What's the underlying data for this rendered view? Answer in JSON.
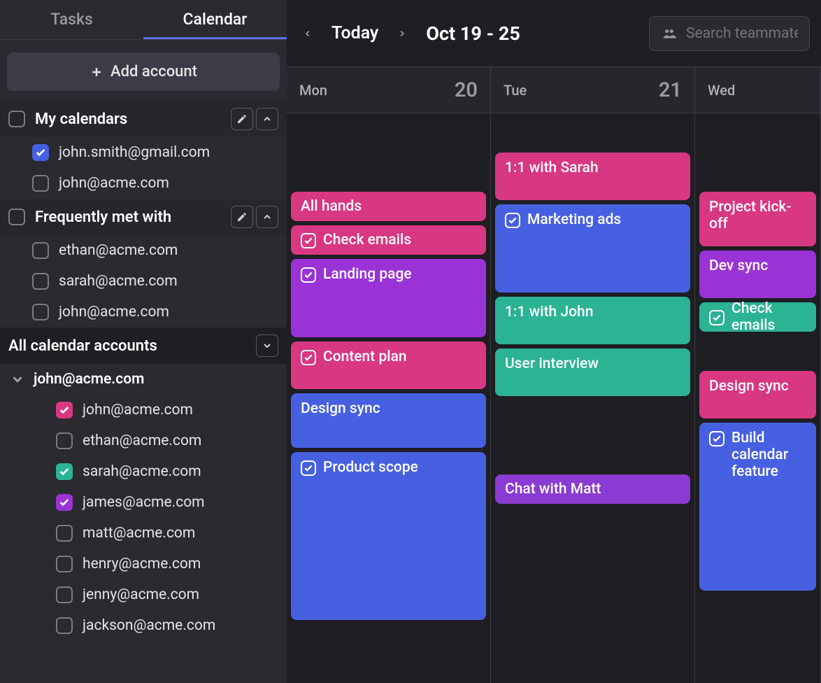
{
  "sidebar": {
    "tabs": [
      {
        "label": "Tasks",
        "active": false
      },
      {
        "label": "Calendar",
        "active": true
      }
    ],
    "add_account_label": "Add account",
    "sections": [
      {
        "id": "my-calendars",
        "title": "My calendars",
        "has_edit": true,
        "has_collapse": true,
        "items": [
          {
            "label": "john.smith@gmail.com",
            "checked": true,
            "color": "#4760e1"
          },
          {
            "label": "john@acme.com",
            "checked": false
          }
        ]
      },
      {
        "id": "frequently-met",
        "title": "Frequently met with",
        "has_edit": true,
        "has_collapse": true,
        "items": [
          {
            "label": "ethan@acme.com",
            "checked": false
          },
          {
            "label": "sarah@acme.com",
            "checked": false
          },
          {
            "label": "john@acme.com",
            "checked": false
          }
        ]
      }
    ],
    "all_accounts_title": "All calendar accounts",
    "accounts": [
      {
        "email": "john@acme.com",
        "expanded": true,
        "calendars": [
          {
            "label": "john@acme.com",
            "checked": true,
            "color": "#d83781"
          },
          {
            "label": "ethan@acme.com",
            "checked": false
          },
          {
            "label": "sarah@acme.com",
            "checked": true,
            "color": "#2bb394"
          },
          {
            "label": "james@acme.com",
            "checked": true,
            "color": "#9a33d6"
          },
          {
            "label": "matt@acme.com",
            "checked": false
          },
          {
            "label": "henry@acme.com",
            "checked": false
          },
          {
            "label": "jenny@acme.com",
            "checked": false
          },
          {
            "label": "jackson@acme.com",
            "checked": false
          }
        ]
      }
    ]
  },
  "header": {
    "today_label": "Today",
    "date_range": "Oct 19 - 25",
    "search_placeholder": "Search teammates"
  },
  "calendar": {
    "days": [
      {
        "name": "Mon",
        "num": "20",
        "events": [
          {
            "title": "All hands",
            "color": "pink",
            "has_check": false,
            "size": "h40",
            "gap_before": "gap100"
          },
          {
            "title": "Check emails",
            "color": "pink",
            "has_check": true,
            "size": "h40"
          },
          {
            "title": "Landing page",
            "color": "purple",
            "has_check": true,
            "size": "h100"
          },
          {
            "title": "Content plan",
            "color": "pink",
            "has_check": true,
            "size": "h70"
          },
          {
            "title": "Design sync",
            "color": "blue",
            "has_check": false,
            "size": "h80"
          },
          {
            "title": "Product scope",
            "color": "blue",
            "has_check": true,
            "size": "h180"
          }
        ]
      },
      {
        "name": "Tue",
        "num": "21",
        "events": [
          {
            "title": "1:1 with Sarah",
            "color": "pink",
            "has_check": false,
            "size": "h70",
            "gap_before": "gap50"
          },
          {
            "title": "Marketing ads",
            "color": "blue",
            "has_check": true,
            "size": "h130"
          },
          {
            "title": "1:1 with John",
            "color": "teal",
            "has_check": false,
            "size": "h70"
          },
          {
            "title": "User interview",
            "color": "teal",
            "has_check": false,
            "size": "h70"
          },
          {
            "title": "Chat with Matt",
            "color": "violet",
            "has_check": false,
            "size": "h40",
            "gap_before": "gap100"
          }
        ]
      },
      {
        "name": "Wed",
        "num": "",
        "events": [
          {
            "title": "Project kick-off",
            "color": "pink",
            "has_check": false,
            "size": "h80",
            "gap_before": "gap100"
          },
          {
            "title": "Dev sync",
            "color": "purple",
            "has_check": false,
            "size": "h70"
          },
          {
            "title": "Check emails",
            "color": "teal",
            "has_check": true,
            "size": "h40"
          },
          {
            "title": "Design sync",
            "color": "pink",
            "has_check": false,
            "size": "h70",
            "gap_before": "gap50"
          },
          {
            "title": "Build calendar feature",
            "color": "blue",
            "has_check": true,
            "size": "h180"
          }
        ]
      }
    ]
  }
}
